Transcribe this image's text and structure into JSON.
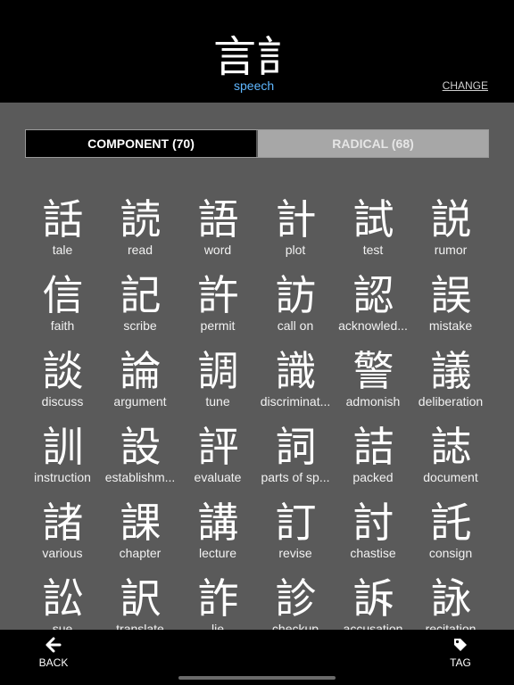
{
  "header": {
    "kanji": "言訁",
    "meaning": "speech",
    "change_label": "CHANGE"
  },
  "tabs": [
    {
      "label": "COMPONENT (70)",
      "active": true
    },
    {
      "label": "RADICAL (68)",
      "active": false
    }
  ],
  "grid": [
    {
      "kanji": "話",
      "meaning": "tale"
    },
    {
      "kanji": "読",
      "meaning": "read"
    },
    {
      "kanji": "語",
      "meaning": "word"
    },
    {
      "kanji": "計",
      "meaning": "plot"
    },
    {
      "kanji": "試",
      "meaning": "test"
    },
    {
      "kanji": "説",
      "meaning": "rumor"
    },
    {
      "kanji": "信",
      "meaning": "faith"
    },
    {
      "kanji": "記",
      "meaning": "scribe"
    },
    {
      "kanji": "許",
      "meaning": "permit"
    },
    {
      "kanji": "訪",
      "meaning": "call on"
    },
    {
      "kanji": "認",
      "meaning": "acknowled..."
    },
    {
      "kanji": "誤",
      "meaning": "mistake"
    },
    {
      "kanji": "談",
      "meaning": "discuss"
    },
    {
      "kanji": "論",
      "meaning": "argument"
    },
    {
      "kanji": "調",
      "meaning": "tune"
    },
    {
      "kanji": "識",
      "meaning": "discriminat..."
    },
    {
      "kanji": "警",
      "meaning": "admonish"
    },
    {
      "kanji": "議",
      "meaning": "deliberation"
    },
    {
      "kanji": "訓",
      "meaning": "instruction"
    },
    {
      "kanji": "設",
      "meaning": "establishm..."
    },
    {
      "kanji": "評",
      "meaning": "evaluate"
    },
    {
      "kanji": "詞",
      "meaning": "parts of sp..."
    },
    {
      "kanji": "詰",
      "meaning": "packed"
    },
    {
      "kanji": "誌",
      "meaning": "document"
    },
    {
      "kanji": "諸",
      "meaning": "various"
    },
    {
      "kanji": "課",
      "meaning": "chapter"
    },
    {
      "kanji": "講",
      "meaning": "lecture"
    },
    {
      "kanji": "訂",
      "meaning": "revise"
    },
    {
      "kanji": "討",
      "meaning": "chastise"
    },
    {
      "kanji": "託",
      "meaning": "consign"
    },
    {
      "kanji": "訟",
      "meaning": "sue"
    },
    {
      "kanji": "訳",
      "meaning": "translate"
    },
    {
      "kanji": "詐",
      "meaning": "lie"
    },
    {
      "kanji": "診",
      "meaning": "checkup"
    },
    {
      "kanji": "訴",
      "meaning": "accusation"
    },
    {
      "kanji": "詠",
      "meaning": "recitation"
    }
  ],
  "toolbar": {
    "back": {
      "icon": "arrow-left-icon",
      "label": "BACK"
    },
    "tag": {
      "icon": "tag-icon",
      "label": "TAG"
    }
  }
}
